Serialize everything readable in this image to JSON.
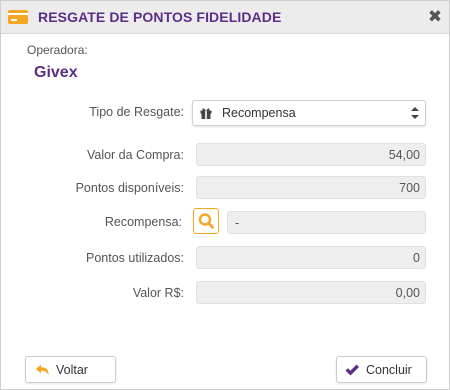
{
  "dialog": {
    "title": "RESGATE DE PONTOS FIDELIDADE",
    "title_icon": "credit-card-icon",
    "close_icon": "close-icon",
    "close_symbol": "✖"
  },
  "operator": {
    "label": "Operadora:",
    "value": "Givex"
  },
  "form": {
    "tipo_resgate": {
      "label": "Tipo de Resgate:",
      "value": "Recompensa",
      "icon": "gift-icon"
    },
    "valor_compra": {
      "label": "Valor da Compra:",
      "value": "54,00"
    },
    "pontos_disponiveis": {
      "label": "Pontos disponíveis:",
      "value": "700"
    },
    "recompensa": {
      "label": "Recompensa:",
      "value": "-",
      "icon": "search-icon"
    },
    "pontos_utilizados": {
      "label": "Pontos utilizados:",
      "value": "0"
    },
    "valor_rs": {
      "label": "Valor R$:",
      "value": "0,00"
    }
  },
  "buttons": {
    "back": {
      "label": "Voltar",
      "icon": "undo-arrow-icon"
    },
    "confirm": {
      "label": "Concluir",
      "icon": "checkmark-icon"
    }
  },
  "colors": {
    "brand_purple": "#5b2f86",
    "accent_orange": "#f5a623"
  }
}
